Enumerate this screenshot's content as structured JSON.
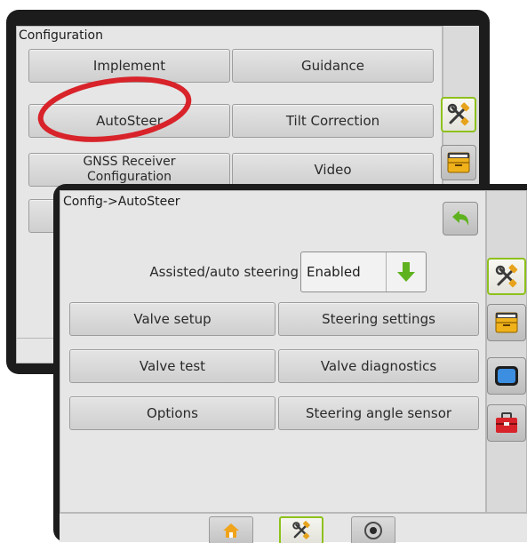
{
  "back_panel": {
    "title": "Configuration",
    "buttons": {
      "implement": "Implement",
      "guidance": "Guidance",
      "autosteer": "AutoSteer",
      "tilt_correction": "Tilt Correction",
      "gnss_receiver": "GNSS Receiver\nConfiguration",
      "video": "Video"
    },
    "side_icons": [
      "tools-icon",
      "file-cabinet-icon"
    ]
  },
  "front_panel": {
    "title": "Config->AutoSteer",
    "assisted_label": "Assisted/auto steering",
    "assisted_value": "Enabled",
    "buttons": {
      "valve_setup": "Valve setup",
      "steering_settings": "Steering settings",
      "valve_test": "Valve test",
      "valve_diagnostics": "Valve diagnostics",
      "options": "Options",
      "steering_angle_sensor": "Steering angle sensor"
    },
    "side_icons": [
      "tools-icon",
      "file-cabinet-icon",
      "blue-screen-icon",
      "red-toolbox-icon"
    ],
    "bottom_tabs": [
      "home-icon",
      "tools-icon",
      "camera-icon"
    ]
  },
  "colors": {
    "frame": "#1c1c1c",
    "panel": "#e6e6e6",
    "active_border": "#8ec11b",
    "highlight_ellipse": "#d8232a",
    "back_arrow": "#5fb21f",
    "down_arrow": "#5fb21f"
  }
}
